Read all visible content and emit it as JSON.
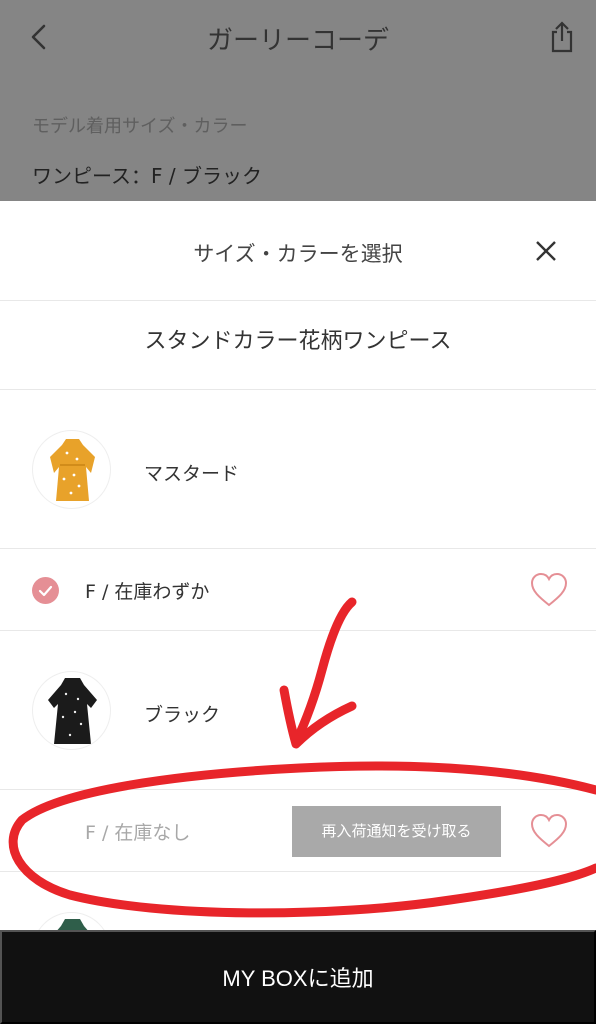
{
  "nav": {
    "title": "ガーリーコーデ",
    "back_icon": "chevron-left-icon",
    "share_icon": "share-icon"
  },
  "model": {
    "label": "モデル着用サイズ・カラー",
    "value": "ワンピース：F / ブラック"
  },
  "sheet": {
    "title": "サイズ・カラーを選択",
    "close_icon": "close-icon",
    "product_name": "スタンドカラー花柄ワンピース",
    "colors": [
      {
        "name": "マスタード",
        "swatch": "#e8a22a",
        "sizes": [
          {
            "label": "F / 在庫わずか",
            "selected": true,
            "available": true
          }
        ]
      },
      {
        "name": "ブラック",
        "swatch": "#1b1b1b",
        "sizes": [
          {
            "label": "F / 在庫なし",
            "selected": false,
            "available": false,
            "notify_label": "再入荷通知を受け取る"
          }
        ]
      },
      {
        "swatch": "#2f5e4a"
      }
    ]
  },
  "footer": {
    "add_button_label": "MY BOXに追加"
  },
  "colors": {
    "accent_pink": "#e58f95",
    "overlay": "#858585",
    "footer_bg": "#111111",
    "annotation_red": "#e8252a"
  }
}
